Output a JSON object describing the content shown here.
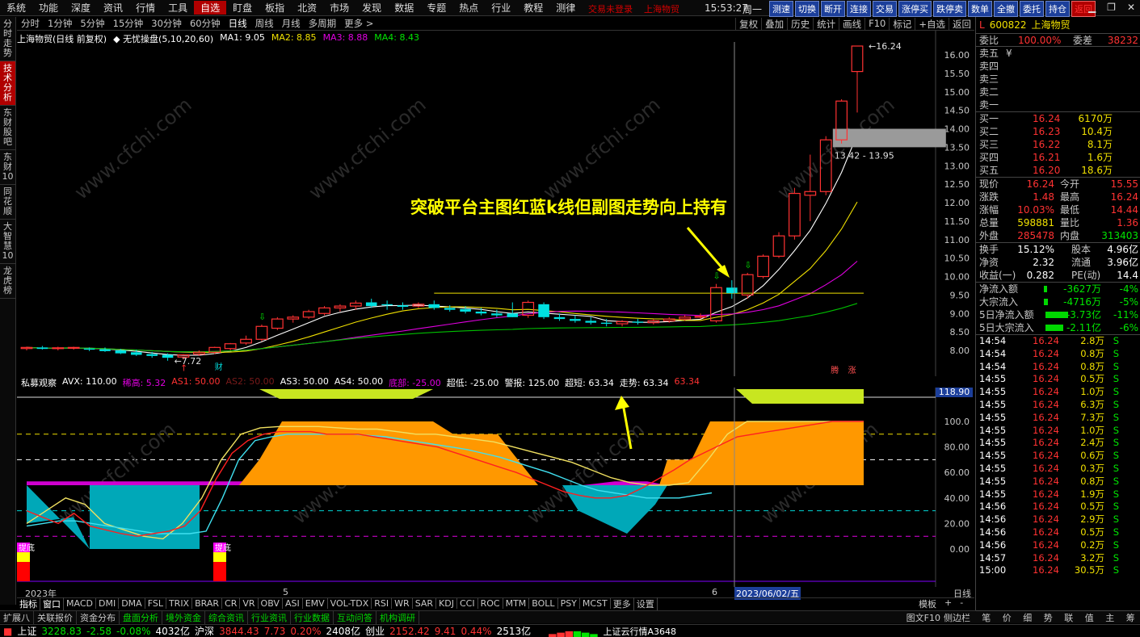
{
  "menu": {
    "items": [
      "系统",
      "功能",
      "深度",
      "资讯",
      "行情",
      "工具",
      "自选",
      "盯盘",
      "板指",
      "北资",
      "市场",
      "发现",
      "数据",
      "专题",
      "热点",
      "行业",
      "教程",
      "测律"
    ],
    "active": "自选",
    "status1": "交易未登录",
    "status2": "上海物贸",
    "clock": "15:53:27",
    "weekday": "周一",
    "buttons": [
      "测速",
      "切换",
      "断开",
      "连接",
      "交易",
      "涨停买",
      "跌停卖",
      "数单",
      "全撤",
      "委托",
      "持仓",
      "返回"
    ],
    "window_icons": [
      "▁",
      "❐",
      "✕"
    ]
  },
  "left_tabs": [
    "分时走势",
    "技术分析",
    "东财股吧",
    "东财10",
    "同花顺",
    "大智慧10",
    "龙虎榜"
  ],
  "left_tab_active": "技术分析",
  "period_bar": {
    "items": [
      "分时",
      "1分钟",
      "5分钟",
      "15分钟",
      "30分钟",
      "60分钟",
      "日线",
      "周线",
      "月线",
      "多周期",
      "更多 >"
    ],
    "active": "日线",
    "right_tools": [
      "复权",
      "叠加",
      "历史",
      "统计",
      "画线",
      "F10",
      "标记",
      "+自选",
      "返回"
    ]
  },
  "main_legend": {
    "stock": "上海物贸(日线 前复权)",
    "formula": "无忧操盘(5,10,20,60)",
    "ma1": "MA1: 9.05",
    "ma2": "MA2: 8.85",
    "ma3": "MA3: 8.88",
    "ma4": "MA4: 8.43"
  },
  "main_axis": {
    "y_labels": [
      "16.00",
      "15.50",
      "15.00",
      "14.50",
      "14.00",
      "13.50",
      "13.00",
      "12.50",
      "12.00",
      "11.50",
      "11.00",
      "10.50",
      "10.00",
      "9.50",
      "9.00",
      "8.50",
      "8.00"
    ],
    "high_label": "16.24",
    "low_label": "7.72",
    "range_label": "13.42 - 13.95",
    "marker_cai": "财",
    "marker_tie": "腾",
    "marker_zhang": "涨"
  },
  "annotation": "突破平台主图红蓝k线但副图走势向上持有",
  "sub_legend": {
    "name": "私募观察",
    "avx": "AVX: 110.00",
    "xigao": "稀高: 5.32",
    "as1": "AS1: 50.00",
    "as2": "AS2: 50.00",
    "as3": "AS3: 50.00",
    "as4": "AS4: 50.00",
    "dibu": "底部: -25.00",
    "chaodi": "超低: -25.00",
    "jingbao": "警报: 125.00",
    "chaoduan": "超短: 63.34",
    "zoushi": "走势: 63.34",
    "extra": "63.34"
  },
  "sub_axis": {
    "y_labels": [
      "100.0",
      "80.00",
      "60.00",
      "40.00",
      "20.00",
      "0.00"
    ],
    "cursor_value": "118.90",
    "label_ti_di": "提底"
  },
  "x_labels": {
    "year": "2023年",
    "m5": "5",
    "m6": "6",
    "cursor_date": "2023/06/02/五",
    "period": "日线"
  },
  "bottom_tabs": [
    "指标",
    "窗口",
    "MACD",
    "DMI",
    "DMA",
    "FSL",
    "TRIX",
    "BRAR",
    "CR",
    "VR",
    "OBV",
    "ASI",
    "EMV",
    "VOL-TDX",
    "RSI",
    "WR",
    "SAR",
    "KDJ",
    "CCI",
    "ROC",
    "MTM",
    "BOLL",
    "PSY",
    "MCST",
    "更多",
    "设置"
  ],
  "bottom_right": [
    "模板",
    "+",
    "-"
  ],
  "status_tabs": [
    "扩展八",
    "关联报价",
    "资金分布",
    "盘面分析",
    "境外资金",
    "综合资讯",
    "行业资讯",
    "行业数据",
    "互动问答",
    "机构调研"
  ],
  "status_right": [
    "图文F10",
    "侧边栏"
  ],
  "index_bar": {
    "sh_name": "上证",
    "sh_val": "3228.83",
    "sh_chg": "-2.58",
    "sh_pct": "-0.08%",
    "sh_amt": "4032亿",
    "hs_name": "沪深",
    "hs_val": "3844.43",
    "hs_chg": "7.73",
    "hs_pct": "0.20%",
    "hs_amt": "2408亿",
    "cy_name": "创业",
    "cy_val": "2152.42",
    "cy_chg": "9.41",
    "cy_pct": "0.44%",
    "cy_amt": "2513亿",
    "feed": "上证云行情A3648",
    "right_tabs": [
      "笔",
      "价",
      "细",
      "势",
      "联",
      "值",
      "主",
      "筹"
    ]
  },
  "quote": {
    "flag": "L",
    "code": "600822",
    "name": "上海物贸",
    "weibi_label": "委比",
    "weibi": "100.00%",
    "weicha_label": "委差",
    "weicha": "38232",
    "sell": [
      {
        "l": "卖五",
        "p": "",
        "v": ""
      },
      {
        "l": "卖四",
        "p": "",
        "v": ""
      },
      {
        "l": "卖三",
        "p": "",
        "v": ""
      },
      {
        "l": "卖二",
        "p": "",
        "v": ""
      },
      {
        "l": "卖一",
        "p": "",
        "v": ""
      }
    ],
    "sell5_sym": "¥",
    "buy": [
      {
        "l": "买一",
        "p": "16.24",
        "v": "6170万"
      },
      {
        "l": "买二",
        "p": "16.23",
        "v": "10.4万"
      },
      {
        "l": "买三",
        "p": "16.22",
        "v": "8.1万"
      },
      {
        "l": "买四",
        "p": "16.21",
        "v": "1.6万"
      },
      {
        "l": "买五",
        "p": "16.20",
        "v": "18.6万"
      }
    ],
    "stats": [
      {
        "a": "现价",
        "av": "16.24",
        "b": "今开",
        "bv": "15.55",
        "ac": "red",
        "bc": "red"
      },
      {
        "a": "涨跌",
        "av": "1.48",
        "b": "最高",
        "bv": "16.24",
        "ac": "red",
        "bc": "red"
      },
      {
        "a": "涨幅",
        "av": "10.03%",
        "b": "最低",
        "bv": "14.44",
        "ac": "red",
        "bc": "red"
      },
      {
        "a": "总量",
        "av": "598881",
        "b": "量比",
        "bv": "1.36",
        "ac": "yellow",
        "bc": "red"
      },
      {
        "a": "外盘",
        "av": "285478",
        "b": "内盘",
        "bv": "313403",
        "ac": "red",
        "bc": "green"
      }
    ],
    "stats2": [
      {
        "a": "换手",
        "av": "15.12%",
        "b": "股本",
        "bv": "4.96亿"
      },
      {
        "a": "净资",
        "av": "2.32",
        "b": "流通",
        "bv": "3.96亿"
      },
      {
        "a": "收益(一)",
        "av": "0.282",
        "b": "PE(动)",
        "bv": "14.4"
      }
    ],
    "flows": [
      {
        "l": "净流入额",
        "v": "-3627万",
        "p": "-4%"
      },
      {
        "l": "大宗流入",
        "v": "-4716万",
        "p": "-5%"
      },
      {
        "l": "5日净流入额",
        "v": "-3.73亿",
        "p": "-11%"
      },
      {
        "l": "5日大宗流入",
        "v": "-2.11亿",
        "p": "-6%"
      }
    ]
  },
  "ticks": [
    {
      "t": "14:54",
      "p": "16.24",
      "v": "2.8万",
      "s": "S"
    },
    {
      "t": "14:54",
      "p": "16.24",
      "v": "0.8万",
      "s": "S"
    },
    {
      "t": "14:54",
      "p": "16.24",
      "v": "0.8万",
      "s": "S"
    },
    {
      "t": "14:55",
      "p": "16.24",
      "v": "0.5万",
      "s": "S"
    },
    {
      "t": "14:55",
      "p": "16.24",
      "v": "1.0万",
      "s": "S"
    },
    {
      "t": "14:55",
      "p": "16.24",
      "v": "6.3万",
      "s": "S"
    },
    {
      "t": "14:55",
      "p": "16.24",
      "v": "7.3万",
      "s": "S"
    },
    {
      "t": "14:55",
      "p": "16.24",
      "v": "1.0万",
      "s": "S"
    },
    {
      "t": "14:55",
      "p": "16.24",
      "v": "2.4万",
      "s": "S"
    },
    {
      "t": "14:55",
      "p": "16.24",
      "v": "0.6万",
      "s": "S"
    },
    {
      "t": "14:55",
      "p": "16.24",
      "v": "0.3万",
      "s": "S"
    },
    {
      "t": "14:55",
      "p": "16.24",
      "v": "0.8万",
      "s": "S"
    },
    {
      "t": "14:55",
      "p": "16.24",
      "v": "1.9万",
      "s": "S"
    },
    {
      "t": "14:56",
      "p": "16.24",
      "v": "0.5万",
      "s": "S"
    },
    {
      "t": "14:56",
      "p": "16.24",
      "v": "2.9万",
      "s": "S"
    },
    {
      "t": "14:56",
      "p": "16.24",
      "v": "0.5万",
      "s": "S"
    },
    {
      "t": "14:56",
      "p": "16.24",
      "v": "0.2万",
      "s": "S"
    },
    {
      "t": "14:57",
      "p": "16.24",
      "v": "3.2万",
      "s": "S"
    },
    {
      "t": "15:00",
      "p": "16.24",
      "v": "30.5万",
      "s": "S"
    }
  ],
  "candles": [
    [
      8.05,
      8.1,
      8.0,
      8.08
    ],
    [
      8.08,
      8.12,
      8.02,
      8.04
    ],
    [
      8.05,
      8.1,
      8.0,
      8.07
    ],
    [
      8.06,
      8.1,
      8.02,
      8.08
    ],
    [
      8.05,
      8.08,
      7.98,
      8.02
    ],
    [
      8.03,
      8.08,
      7.96,
      7.98
    ],
    [
      8.0,
      8.04,
      7.9,
      7.92
    ],
    [
      7.95,
      8.02,
      7.85,
      7.88
    ],
    [
      7.9,
      7.96,
      7.8,
      7.85
    ],
    [
      7.88,
      7.92,
      7.72,
      7.8
    ],
    [
      7.82,
      7.9,
      7.75,
      7.88
    ],
    [
      7.9,
      8.0,
      7.85,
      7.95
    ],
    [
      7.95,
      8.1,
      7.9,
      8.08
    ],
    [
      8.05,
      8.2,
      8.0,
      8.18
    ],
    [
      8.2,
      8.4,
      8.15,
      8.3
    ],
    [
      8.3,
      8.7,
      8.25,
      8.65
    ],
    [
      8.6,
      8.9,
      8.55,
      8.85
    ],
    [
      8.85,
      8.95,
      8.75,
      8.9
    ],
    [
      8.9,
      9.1,
      8.85,
      9.05
    ],
    [
      9.0,
      9.2,
      8.95,
      9.15
    ],
    [
      9.15,
      9.25,
      9.05,
      9.2
    ],
    [
      9.2,
      9.35,
      9.1,
      9.28
    ],
    [
      9.3,
      9.4,
      9.15,
      9.2
    ],
    [
      9.25,
      9.35,
      9.1,
      9.22
    ],
    [
      9.22,
      9.3,
      9.1,
      9.18
    ],
    [
      9.2,
      9.3,
      9.15,
      9.25
    ],
    [
      9.25,
      9.35,
      9.1,
      9.15
    ],
    [
      9.15,
      9.22,
      9.05,
      9.1
    ],
    [
      9.12,
      9.2,
      9.0,
      9.05
    ],
    [
      9.05,
      9.15,
      8.95,
      9.0
    ],
    [
      9.0,
      9.1,
      8.9,
      8.95
    ],
    [
      9.0,
      9.3,
      8.95,
      8.9
    ],
    [
      8.95,
      9.35,
      8.88,
      9.3
    ],
    [
      9.25,
      9.3,
      8.85,
      8.9
    ],
    [
      8.9,
      9.0,
      8.8,
      8.85
    ],
    [
      8.85,
      8.95,
      8.75,
      8.8
    ],
    [
      8.8,
      8.9,
      8.7,
      8.75
    ],
    [
      8.75,
      8.85,
      8.65,
      8.72
    ],
    [
      8.72,
      8.82,
      8.65,
      8.78
    ],
    [
      8.78,
      8.85,
      8.7,
      8.75
    ],
    [
      8.75,
      8.85,
      8.7,
      8.8
    ],
    [
      8.8,
      8.9,
      8.75,
      8.85
    ],
    [
      8.85,
      8.95,
      8.8,
      8.9
    ],
    [
      8.9,
      9.0,
      8.85,
      8.92
    ],
    [
      8.8,
      9.8,
      8.75,
      9.7
    ],
    [
      9.7,
      9.9,
      9.4,
      9.55
    ],
    [
      9.5,
      10.1,
      9.4,
      10.05
    ],
    [
      10.0,
      10.6,
      9.95,
      10.55
    ],
    [
      10.55,
      11.2,
      10.5,
      11.1
    ],
    [
      11.1,
      12.4,
      11.0,
      12.25
    ],
    [
      12.2,
      13.3,
      11.5,
      12.3
    ],
    [
      12.3,
      13.8,
      12.2,
      13.7
    ],
    [
      13.7,
      14.8,
      13.6,
      14.75
    ],
    [
      15.55,
      16.24,
      14.44,
      16.24
    ]
  ],
  "sub_series": {
    "red": [
      30,
      25,
      20,
      28,
      18,
      15,
      12,
      10,
      12,
      14,
      18,
      30,
      55,
      75,
      85,
      90,
      92,
      92,
      92,
      90,
      90,
      90,
      88,
      86,
      84,
      82,
      80,
      76,
      72,
      68,
      64,
      60,
      55,
      50,
      45,
      42,
      40,
      40,
      42,
      48,
      55,
      62,
      70,
      76,
      82,
      88,
      90,
      92,
      94,
      96,
      98,
      100,
      100,
      100
    ],
    "cyan": [
      18,
      20,
      22,
      22,
      20,
      18,
      16,
      14,
      12,
      12,
      12,
      14,
      40,
      70,
      85,
      88,
      90,
      90,
      90,
      90,
      90,
      89,
      88,
      86,
      84,
      82,
      80,
      78,
      75,
      72,
      68,
      64,
      60,
      55,
      50,
      46,
      44,
      42,
      40,
      40,
      40,
      42,
      44
    ],
    "yellow": [
      20,
      30,
      40,
      35,
      20,
      15,
      10,
      8,
      20,
      40,
      70,
      90,
      95,
      96,
      96,
      96,
      95,
      94,
      94,
      92,
      90,
      90,
      88,
      86,
      84,
      80,
      76,
      72,
      68,
      62,
      56,
      52,
      50,
      50,
      52,
      70,
      90,
      100,
      100,
      100,
      100,
      100,
      100,
      100
    ]
  }
}
